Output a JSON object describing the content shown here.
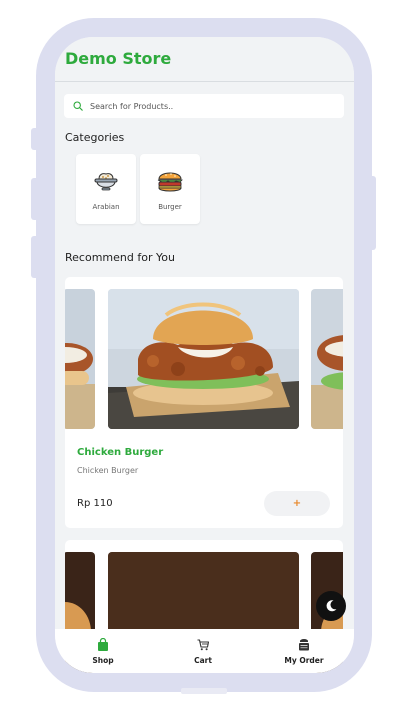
{
  "app": {
    "title": "Demo Store"
  },
  "search": {
    "placeholder": "Search for Products.."
  },
  "categories": {
    "title": "Categories",
    "items": [
      {
        "label": "Arabian",
        "icon": "rice-bowl-icon"
      },
      {
        "label": "Burger",
        "icon": "burger-icon"
      }
    ]
  },
  "recommend": {
    "title": "Recommend for You",
    "products": [
      {
        "name": "Chicken Burger",
        "description": "Chicken Burger",
        "price": "Rp 110",
        "add_label": "+"
      }
    ]
  },
  "nav": {
    "items": [
      {
        "label": "Shop",
        "icon": "shopping-bag-icon"
      },
      {
        "label": "Cart",
        "icon": "cart-icon"
      },
      {
        "label": "My Order",
        "icon": "order-box-icon"
      }
    ]
  },
  "colors": {
    "accent": "#2eaa3d",
    "add_plus": "#e8892b",
    "frame": "#dcdef0"
  }
}
